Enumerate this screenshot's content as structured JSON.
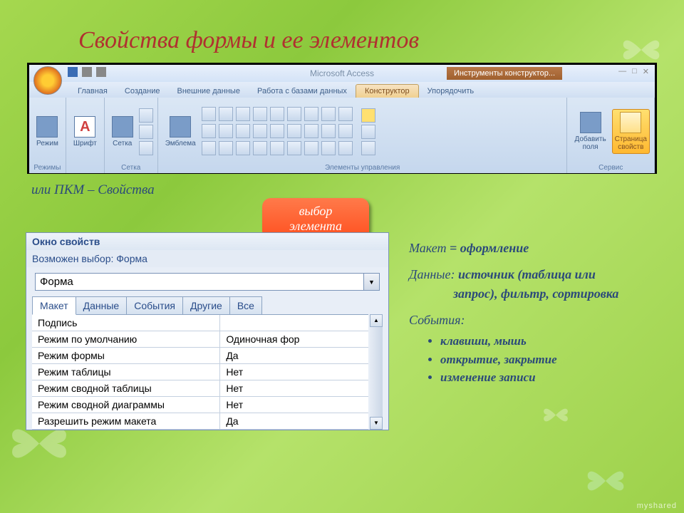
{
  "slide": {
    "title": "Свойства формы и ее элементов",
    "pkm_note": "или ПКМ – Свойства",
    "watermark": "myshared"
  },
  "callout": {
    "line1": "выбор",
    "line2": "элемента"
  },
  "ribbon": {
    "app_title": "Microsoft Access",
    "tool_tab": "Инструменты конструктор...",
    "tabs": {
      "home": "Главная",
      "create": "Создание",
      "external": "Внешние данные",
      "dbtools": "Работа с базами данных",
      "konstruktor": "Конструктор",
      "arrange": "Упорядочить"
    },
    "groups": {
      "mode": "Режимы",
      "font": "Шрифт",
      "grid": "Сетка",
      "controls": "Элементы управления",
      "service": "Сервис"
    },
    "buttons": {
      "mode": "Режим",
      "font": "Шрифт",
      "grid": "Сетка",
      "emblem": "Эмблема",
      "addfield": "Добавить\nполя",
      "propsheet": "Страница\nсвойств"
    }
  },
  "props": {
    "title": "Окно свойств",
    "subtitle": "Возможен выбор: Форма",
    "selector_value": "Форма",
    "tabs": [
      "Макет",
      "Данные",
      "События",
      "Другие",
      "Все"
    ],
    "rows": [
      {
        "label": "Подпись",
        "value": ""
      },
      {
        "label": "Режим по умолчанию",
        "value": "Одиночная фор"
      },
      {
        "label": "Режим формы",
        "value": "Да"
      },
      {
        "label": "Режим таблицы",
        "value": "Нет"
      },
      {
        "label": "Режим сводной таблицы",
        "value": "Нет"
      },
      {
        "label": "Режим сводной диаграммы",
        "value": "Нет"
      },
      {
        "label": "Разрешить режим макета",
        "value": "Да"
      }
    ]
  },
  "explain": {
    "maket_label": "Макет",
    "maket_eq": " = оформление",
    "dannye_label": "Данные: ",
    "dannye_txt1": "источник (таблица или",
    "dannye_txt2": "запрос), фильтр, сортировка",
    "sobytia_label": "События:",
    "bullets": [
      "клавиши, мышь",
      "открытие, закрытие",
      "изменение записи"
    ]
  }
}
